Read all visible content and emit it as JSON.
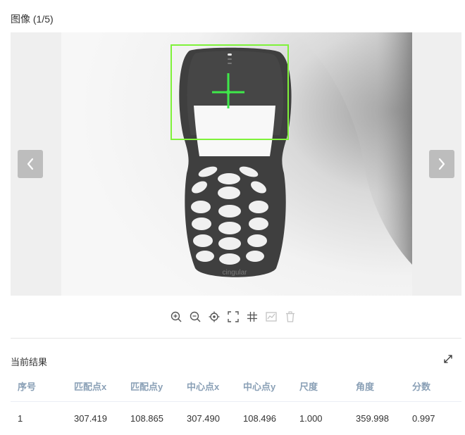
{
  "viewer": {
    "title": "图像  (1/5)",
    "image_label": "cingular",
    "icons": {
      "prev": "chevron-left-icon",
      "next": "chevron-right-icon"
    },
    "colors": {
      "match_box": "#7ff23a",
      "match_cross": "#3fe84a",
      "nav_button": "#bdbdbd"
    }
  },
  "toolbar": {
    "items": [
      {
        "name": "zoom-in-icon",
        "enabled": true
      },
      {
        "name": "zoom-out-icon",
        "enabled": true
      },
      {
        "name": "locate-icon",
        "enabled": true
      },
      {
        "name": "fullscreen-icon",
        "enabled": true
      },
      {
        "name": "grid-icon",
        "enabled": true
      },
      {
        "name": "image-chart-icon",
        "enabled": false
      },
      {
        "name": "trash-icon",
        "enabled": false
      }
    ]
  },
  "results": {
    "title": "当前结果",
    "expand_icon": "expand-icon",
    "columns": [
      "序号",
      "匹配点x",
      "匹配点y",
      "中心点x",
      "中心点y",
      "尺度",
      "角度",
      "分数"
    ],
    "rows": [
      [
        "1",
        "307.419",
        "108.865",
        "307.490",
        "108.496",
        "1.000",
        "359.998",
        "0.997"
      ]
    ]
  }
}
